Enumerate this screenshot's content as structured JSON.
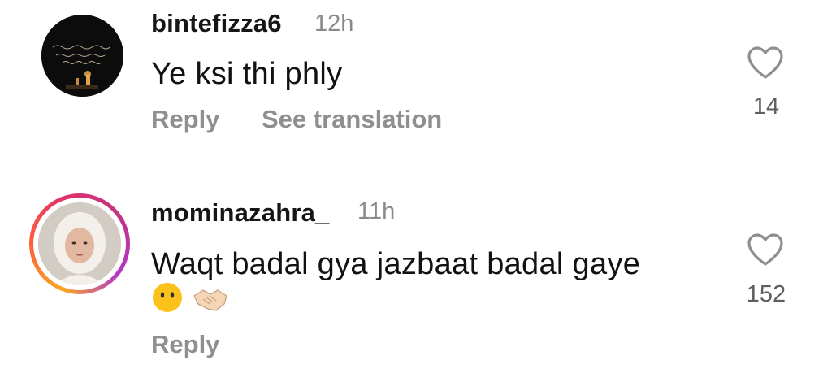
{
  "comments": [
    {
      "username": "bintefizza6",
      "time": "12h",
      "text": "Ye ksi thi phly",
      "actions": {
        "reply": "Reply",
        "translate": "See translation"
      },
      "likes": "14"
    },
    {
      "username": "mominazahra_",
      "time": "11h",
      "text": "Waqt badal gya jazbaat badal gaye",
      "emojis": [
        "neutral-face",
        "handshake"
      ],
      "actions": {
        "reply": "Reply"
      },
      "likes": "152"
    }
  ],
  "colors": {
    "username": "#161616",
    "muted": "#8f8f8f",
    "like_count": "#5f5f5f",
    "story_ring": [
      "#f9a825",
      "#e1306c",
      "#b236c8"
    ]
  }
}
